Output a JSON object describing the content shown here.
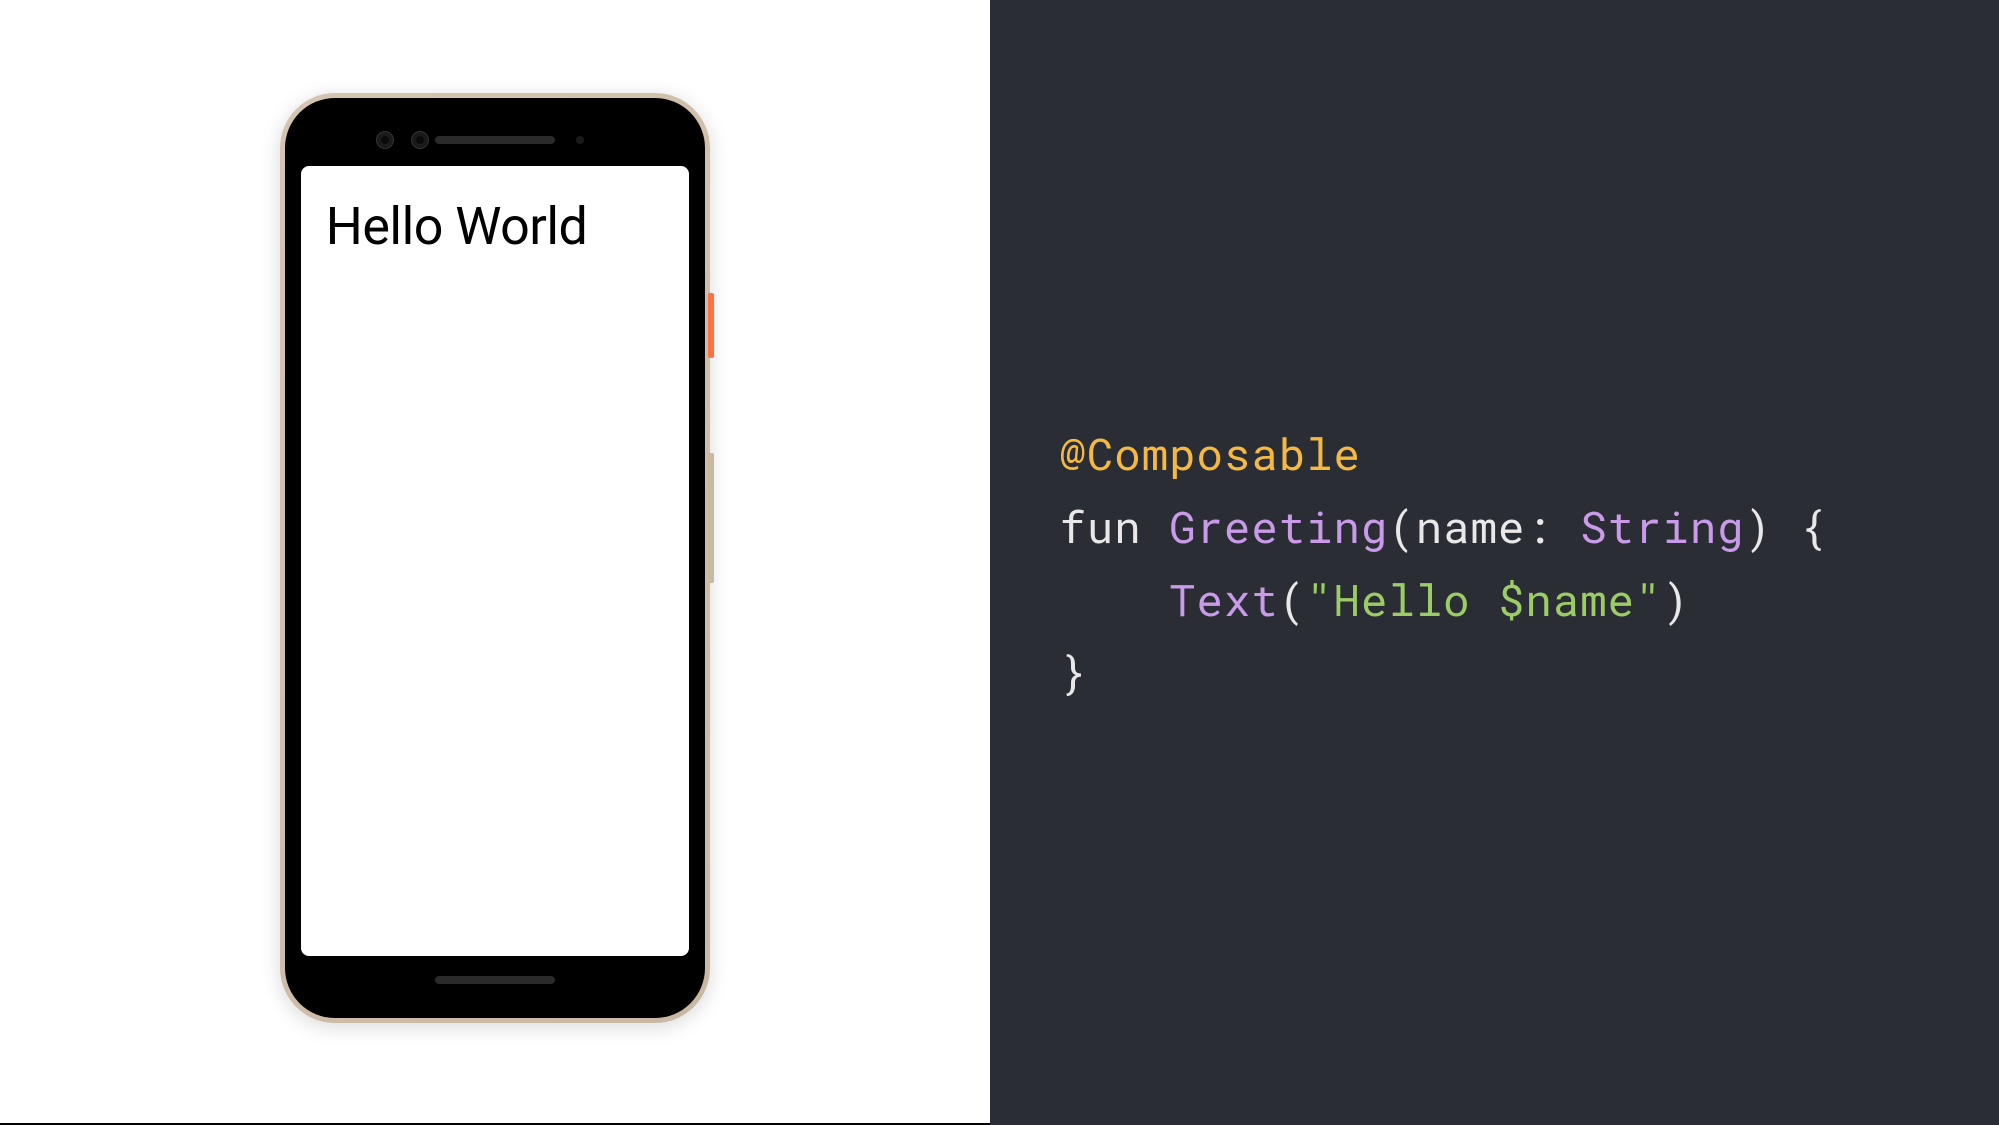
{
  "phone": {
    "screen_text": "Hello World"
  },
  "code": {
    "annotation": "@Composable",
    "keyword_fun": "fun",
    "function_name": "Greeting",
    "param_name": "name",
    "colon": ":",
    "param_type": "String",
    "open_paren": "(",
    "close_paren": ")",
    "open_brace": "{",
    "close_brace": "}",
    "call_name": "Text",
    "string_literal": "\"Hello $name\"",
    "indent": "    ",
    "space": " "
  }
}
